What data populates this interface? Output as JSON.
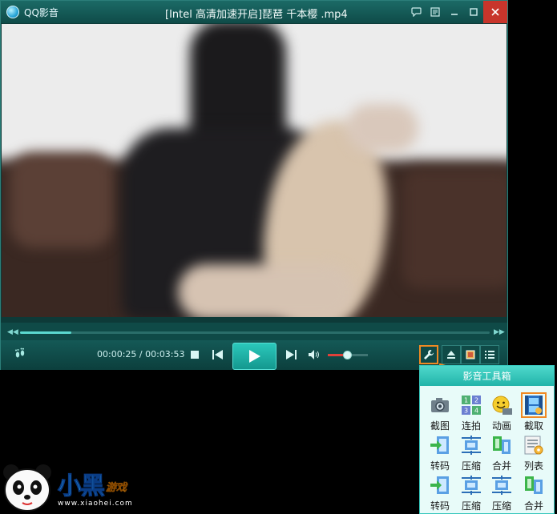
{
  "window": {
    "app_name": "QQ影音",
    "title": "[Intel 高清加速开启]琵琶 千本樱 .mp4"
  },
  "player": {
    "time_current": "00:00:25",
    "time_separator": " / ",
    "time_total": "00:03:53",
    "progress_fraction": 0.11,
    "volume_fraction": 0.47
  },
  "toolbox": {
    "title": "影音工具箱",
    "items": [
      {
        "label": "截图",
        "icon": "camera-icon"
      },
      {
        "label": "连拍",
        "icon": "burst-shot-icon"
      },
      {
        "label": "动画",
        "icon": "gif-smiley-icon"
      },
      {
        "label": "截取",
        "icon": "clip-film-icon"
      },
      {
        "label": "转码",
        "icon": "transcode-icon"
      },
      {
        "label": "压缩",
        "icon": "compress-icon"
      },
      {
        "label": "合并",
        "icon": "merge-icon"
      },
      {
        "label": "列表",
        "icon": "list-settings-icon"
      },
      {
        "label": "转码",
        "icon": "transcode-icon"
      },
      {
        "label": "压缩",
        "icon": "compress-icon"
      },
      {
        "label": "压缩",
        "icon": "compress-icon"
      },
      {
        "label": "合并",
        "icon": "merge-icon"
      }
    ]
  },
  "watermark": {
    "brand": "小黑",
    "sub": "游戏",
    "url": "www.xiaohei.com"
  },
  "colors": {
    "accent": "#f08a23",
    "theme": "#145956",
    "close": "#c8352b",
    "highlight_play": "#2bc8bb"
  }
}
